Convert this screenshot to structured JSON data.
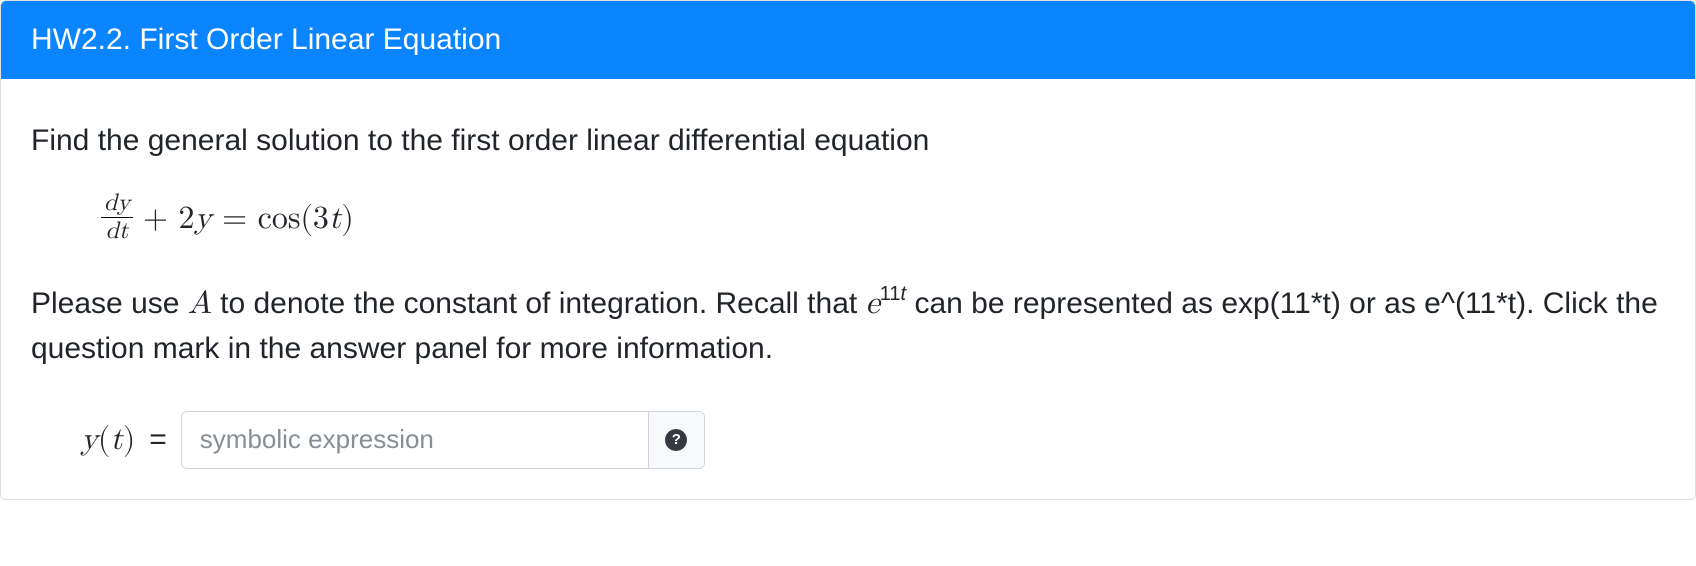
{
  "header": {
    "title": "HW2.2. First Order Linear Equation"
  },
  "question": {
    "prompt": "Find the general solution to the first order linear differential equation",
    "equation": {
      "frac_num": "dy",
      "frac_den": "dt",
      "plus": " + 2",
      "yvar": "y",
      "equals": " = cos(3",
      "tvar": "t",
      "close": ")"
    },
    "hint_pre": "Please use ",
    "hint_A": "A",
    "hint_mid1": " to denote the constant of integration. Recall that ",
    "hint_e": "e",
    "hint_exp_num": "11",
    "hint_exp_var": "t",
    "hint_post": " can be represented as exp(11*t) or as e^(11*t). Click the question mark in the answer panel for more information."
  },
  "answer": {
    "label_y": "y",
    "label_paren_open": "(",
    "label_t": "t",
    "label_paren_close": ")",
    "equals": "=",
    "placeholder": "symbolic expression",
    "help_glyph": "?"
  }
}
